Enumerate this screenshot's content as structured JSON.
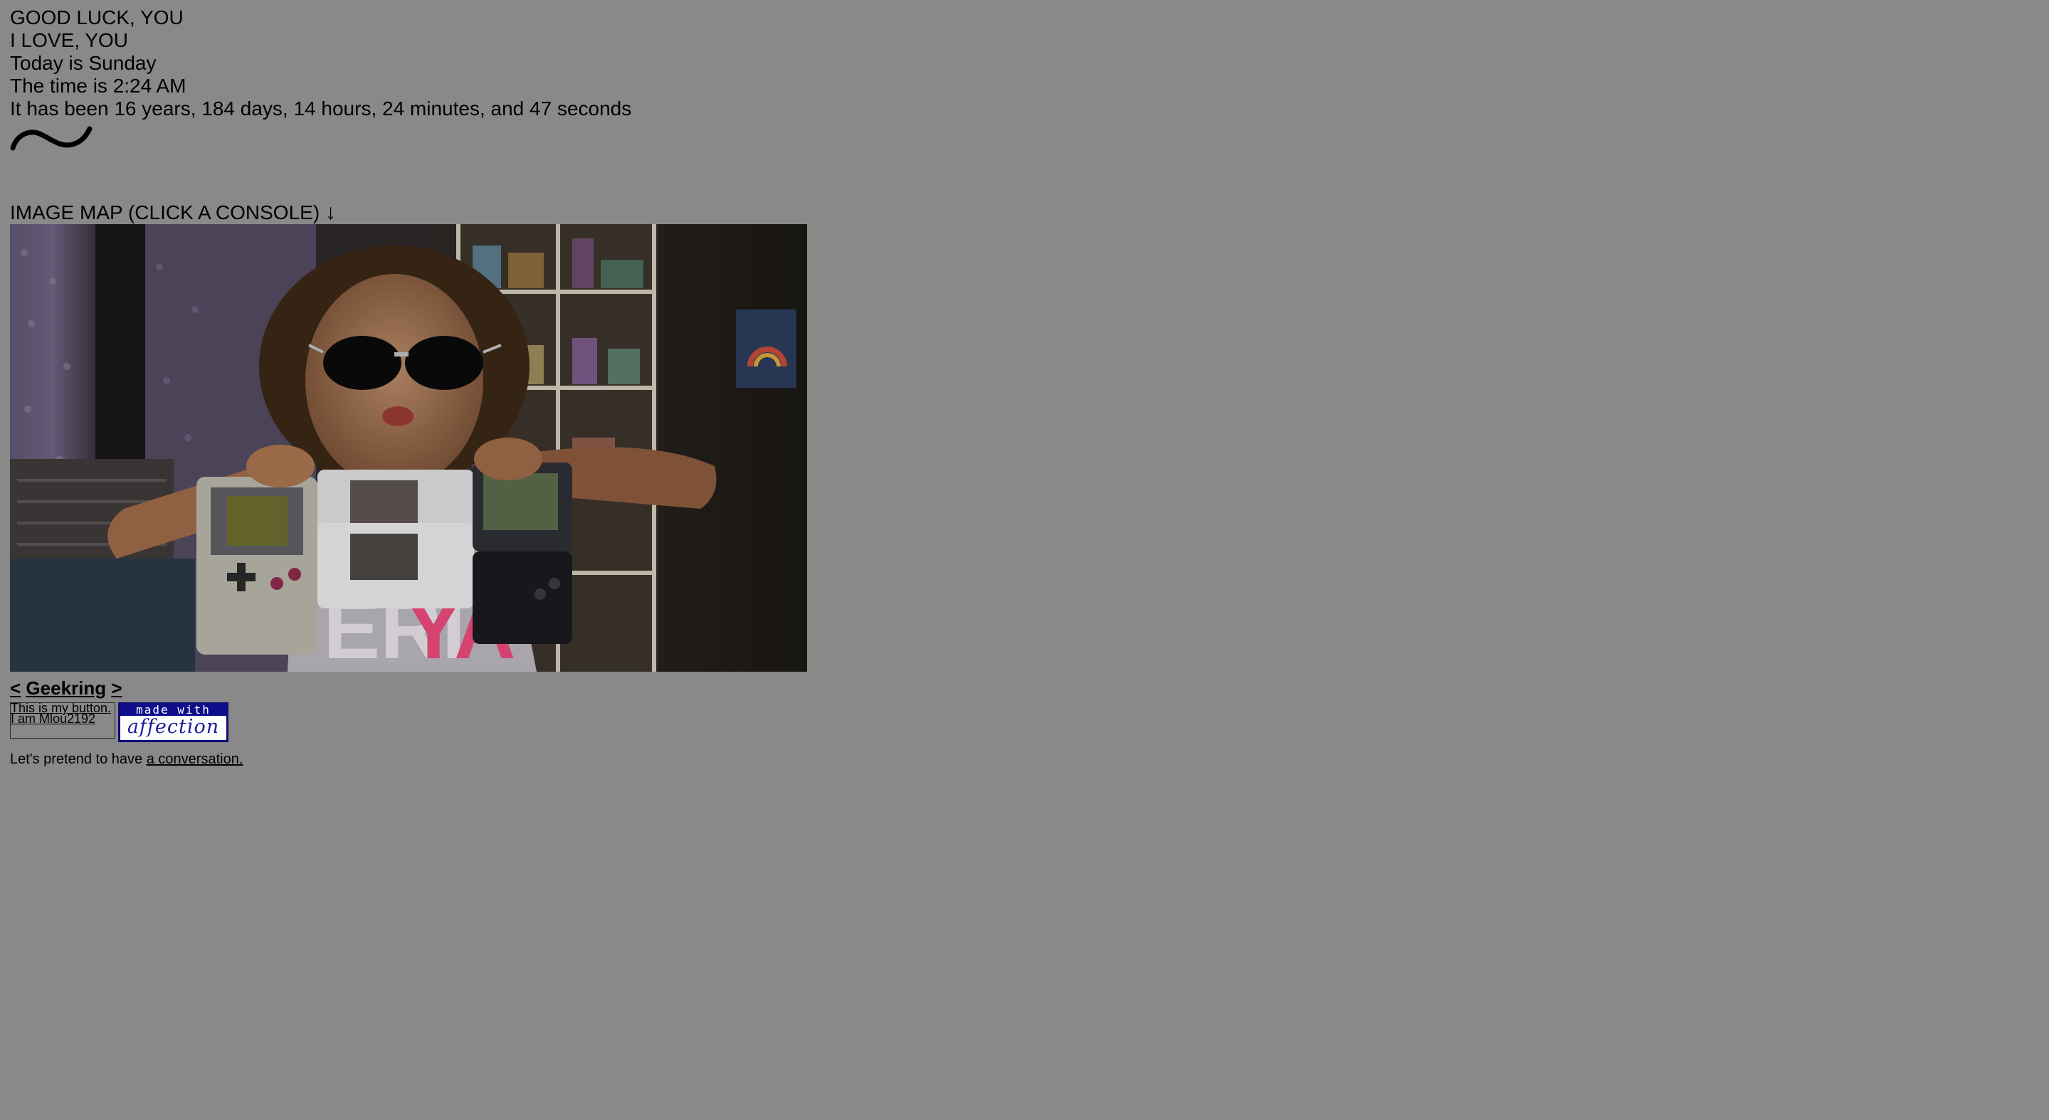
{
  "lines": {
    "good_luck": "GOOD LUCK, YOU",
    "love": "I LOVE, YOU",
    "today": "Today is Sunday",
    "time": "The time is 2:24 AM",
    "elapsed": "It has been 16 years, 184 days, 14 hours, 24 minutes, and 47 seconds"
  },
  "image_map": {
    "heading": "IMAGE MAP (CLICK A CONSOLE)",
    "arrow": "↓",
    "consoles": [
      "Game Boy",
      "Nintendo DS",
      "Game Boy Advance SP"
    ]
  },
  "webring": {
    "prev": "<",
    "name": "Geekring",
    "next": ">"
  },
  "buttons": {
    "my_button": "This is my button. I am Mlou2192",
    "made_with_top": "made with",
    "made_with_bottom": "affection"
  },
  "conversation": {
    "prefix": "Let's pretend to have",
    "link": "a conversation."
  },
  "colors": {
    "background": "#898989",
    "text": "#000000",
    "badge_blue": "#0e0e8c"
  },
  "icons": {
    "tilde": "tilde-squiggle-icon",
    "arrow": "down-arrow-icon"
  }
}
